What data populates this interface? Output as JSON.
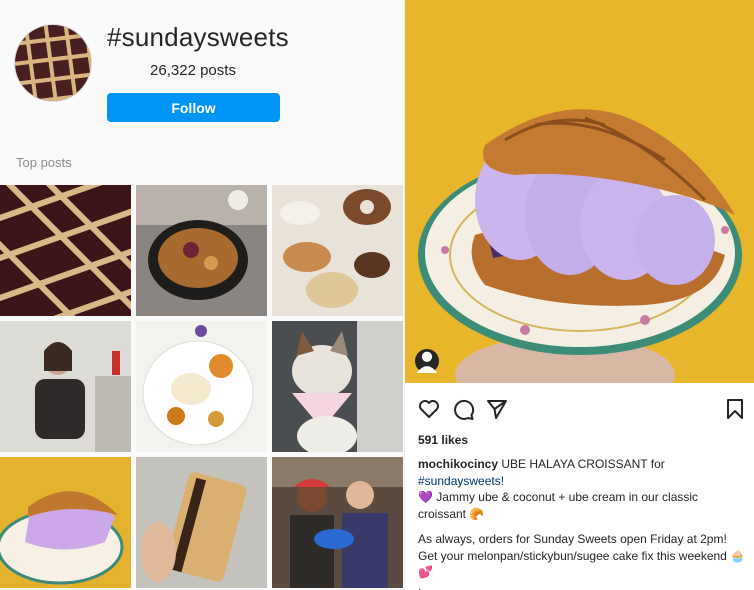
{
  "header": {
    "hashtag": "#sundaysweets",
    "post_count": "26,322 posts",
    "follow_label": "Follow"
  },
  "section": {
    "top_posts_label": "Top posts"
  },
  "post": {
    "likes": "591 likes",
    "username": "mochikocincy",
    "caption_lead": "UBE HALAYA CROISSANT for ",
    "caption_hashtag": "#sundaysweets!",
    "caption_line2": "💜 Jammy ube & coconut + ube cream in our classic croissant 🥐",
    "caption_para2": "As always, orders for Sunday Sweets open Friday at 2pm! Get your melonpan/stickybun/sugee cake fix this weekend 🧁 💕",
    "dots": [
      ".",
      ".",
      "."
    ]
  },
  "icons": {
    "like": "heart-icon",
    "comment": "comment-icon",
    "share": "paper-plane-icon",
    "save": "bookmark-icon",
    "tagged": "user-icon"
  },
  "colors": {
    "follow_blue": "#0095f6",
    "background": "#fafafa",
    "photo_yellow": "#e8b62a",
    "ube_purple": "#c9b6e8",
    "hashtag_link": "#00376b"
  }
}
